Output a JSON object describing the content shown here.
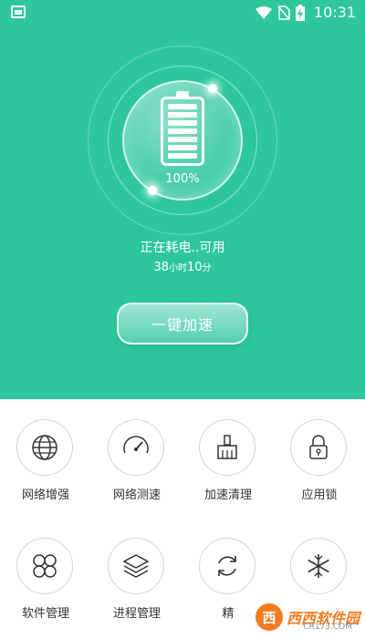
{
  "status_bar": {
    "time": "10:31",
    "icons": [
      "image-icon",
      "wifi-icon",
      "no-sim-icon",
      "battery-charging-icon"
    ]
  },
  "hero": {
    "battery_percent_text": "100%",
    "battery_level": 1.0,
    "status_text": "正在耗电..可用",
    "remaining": {
      "hours": "38",
      "hours_unit": "小时",
      "minutes": "10",
      "minutes_unit": "分"
    },
    "boost_label": "一键加速"
  },
  "tools": [
    {
      "label": "网络增强",
      "icon": "globe-icon"
    },
    {
      "label": "网络测速",
      "icon": "speedometer-icon"
    },
    {
      "label": "加速清理",
      "icon": "broom-icon"
    },
    {
      "label": "应用锁",
      "icon": "lock-icon"
    },
    {
      "label": "软件管理",
      "icon": "apps-icon"
    },
    {
      "label": "进程管理",
      "icon": "layers-icon"
    },
    {
      "label": "精",
      "icon": "refresh-icon"
    },
    {
      "label": "",
      "icon": "snowflake-icon"
    }
  ],
  "watermark": {
    "logo": "西",
    "text": "西西软件园",
    "sub": "CR173.COM"
  },
  "colors": {
    "primary": "#2ec79c",
    "watermark": "#f47c20"
  }
}
